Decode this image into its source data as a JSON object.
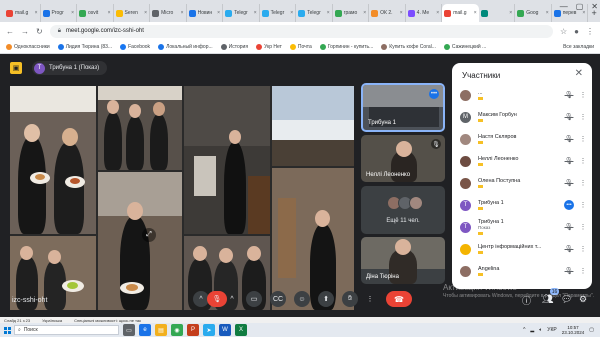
{
  "browser": {
    "tabs": [
      {
        "label": "mail.g",
        "color": "#ea4335"
      },
      {
        "label": "Progr",
        "color": "#1a73e8"
      },
      {
        "label": "osvit",
        "color": "#34a853"
      },
      {
        "label": "Seren",
        "color": "#fbbc04"
      },
      {
        "label": "Micro",
        "color": "#5f6368"
      },
      {
        "label": "Новин",
        "color": "#1a73e8"
      },
      {
        "label": "Telegr",
        "color": "#2aabee"
      },
      {
        "label": "Telegr",
        "color": "#2aabee"
      },
      {
        "label": "Telegr",
        "color": "#2aabee"
      },
      {
        "label": "грамо",
        "color": "#34a853"
      },
      {
        "label": "ОК 2.",
        "color": "#f28c28"
      },
      {
        "label": "4. Me",
        "color": "#7c4dff"
      },
      {
        "label": "mail.g",
        "color": "#ea4335"
      },
      {
        "label": "",
        "color": "#00897b"
      },
      {
        "label": "Goog",
        "color": "#34a853"
      },
      {
        "label": "перев",
        "color": "#1a73e8"
      }
    ],
    "url": "meet.google.com/izc-sshi-oht",
    "bookmarks": [
      {
        "label": "Одноклассники",
        "color": "#f28c28"
      },
      {
        "label": "Лидия Тюрина (83...",
        "color": "#1a73e8"
      },
      {
        "label": "Facebook",
        "color": "#1877f2"
      },
      {
        "label": "Локальный инфор...",
        "color": "#1a73e8"
      },
      {
        "label": "История",
        "color": "#5f6368"
      },
      {
        "label": "Укр Нет",
        "color": "#ea4335"
      },
      {
        "label": "Почта",
        "color": "#fbbc04"
      },
      {
        "label": "Горпинин - купить...",
        "color": "#34a853"
      },
      {
        "label": "Купить кофе Coral...",
        "color": "#8d6e63"
      },
      {
        "label": "Сажинецкий ...",
        "color": "#34a853"
      }
    ],
    "all_bookmarks": "Все закладки"
  },
  "meet": {
    "presenter": "Трибуна 1 (Показ)",
    "tiles": [
      {
        "label": "Трибуна 1"
      },
      {
        "label": "Неллі Леоненко"
      },
      {
        "label": "Ещё 11 чел."
      },
      {
        "label": "Діна Тюріна"
      }
    ],
    "participants_title": "Участники",
    "participants": [
      {
        "name": "...",
        "sub": "",
        "initial": "",
        "color": "#8d6e63",
        "state": "muted"
      },
      {
        "name": "Максим Горбун",
        "sub": "",
        "initial": "М",
        "color": "#5f6368",
        "state": "muted"
      },
      {
        "name": "Настя Скляров",
        "sub": "",
        "initial": "",
        "color": "#a1887f",
        "state": "muted"
      },
      {
        "name": "Неллі Леоненко",
        "sub": "",
        "initial": "",
        "color": "#6d4c41",
        "state": "muted"
      },
      {
        "name": "Олена Поступна",
        "sub": "",
        "initial": "",
        "color": "#795548",
        "state": "muted"
      },
      {
        "name": "Трибуна 1",
        "sub": "",
        "initial": "Т",
        "color": "#7e57c2",
        "state": "speaking"
      },
      {
        "name": "Трибуна 1",
        "sub": "Показ",
        "initial": "Т",
        "color": "#7e57c2",
        "state": "muted"
      },
      {
        "name": "Центр інформаційних т...",
        "sub": "",
        "initial": "",
        "color": "#f4b400",
        "state": "muted"
      },
      {
        "name": "Angelina",
        "sub": "",
        "initial": "",
        "color": "#8d6e63",
        "state": "muted"
      }
    ],
    "meeting_code": "izc-sshi-oht",
    "people_count": "16",
    "colors": {
      "accent": "#8ab4f8",
      "hangup": "#ea4335",
      "bg": "#202124"
    }
  },
  "watermark": {
    "line1": "Активация Windows",
    "line2": "Чтобы активировать Windows, перейдите в раздел \"Параметры\"."
  },
  "statusbar": [
    "Слайд 21 з 23",
    "Українська",
    "Спеціальні можливості: щось не так"
  ],
  "taskbar": {
    "search_placeholder": "Поиск",
    "time": "10:57",
    "date": "23.10.2024",
    "lang": "УКР"
  }
}
